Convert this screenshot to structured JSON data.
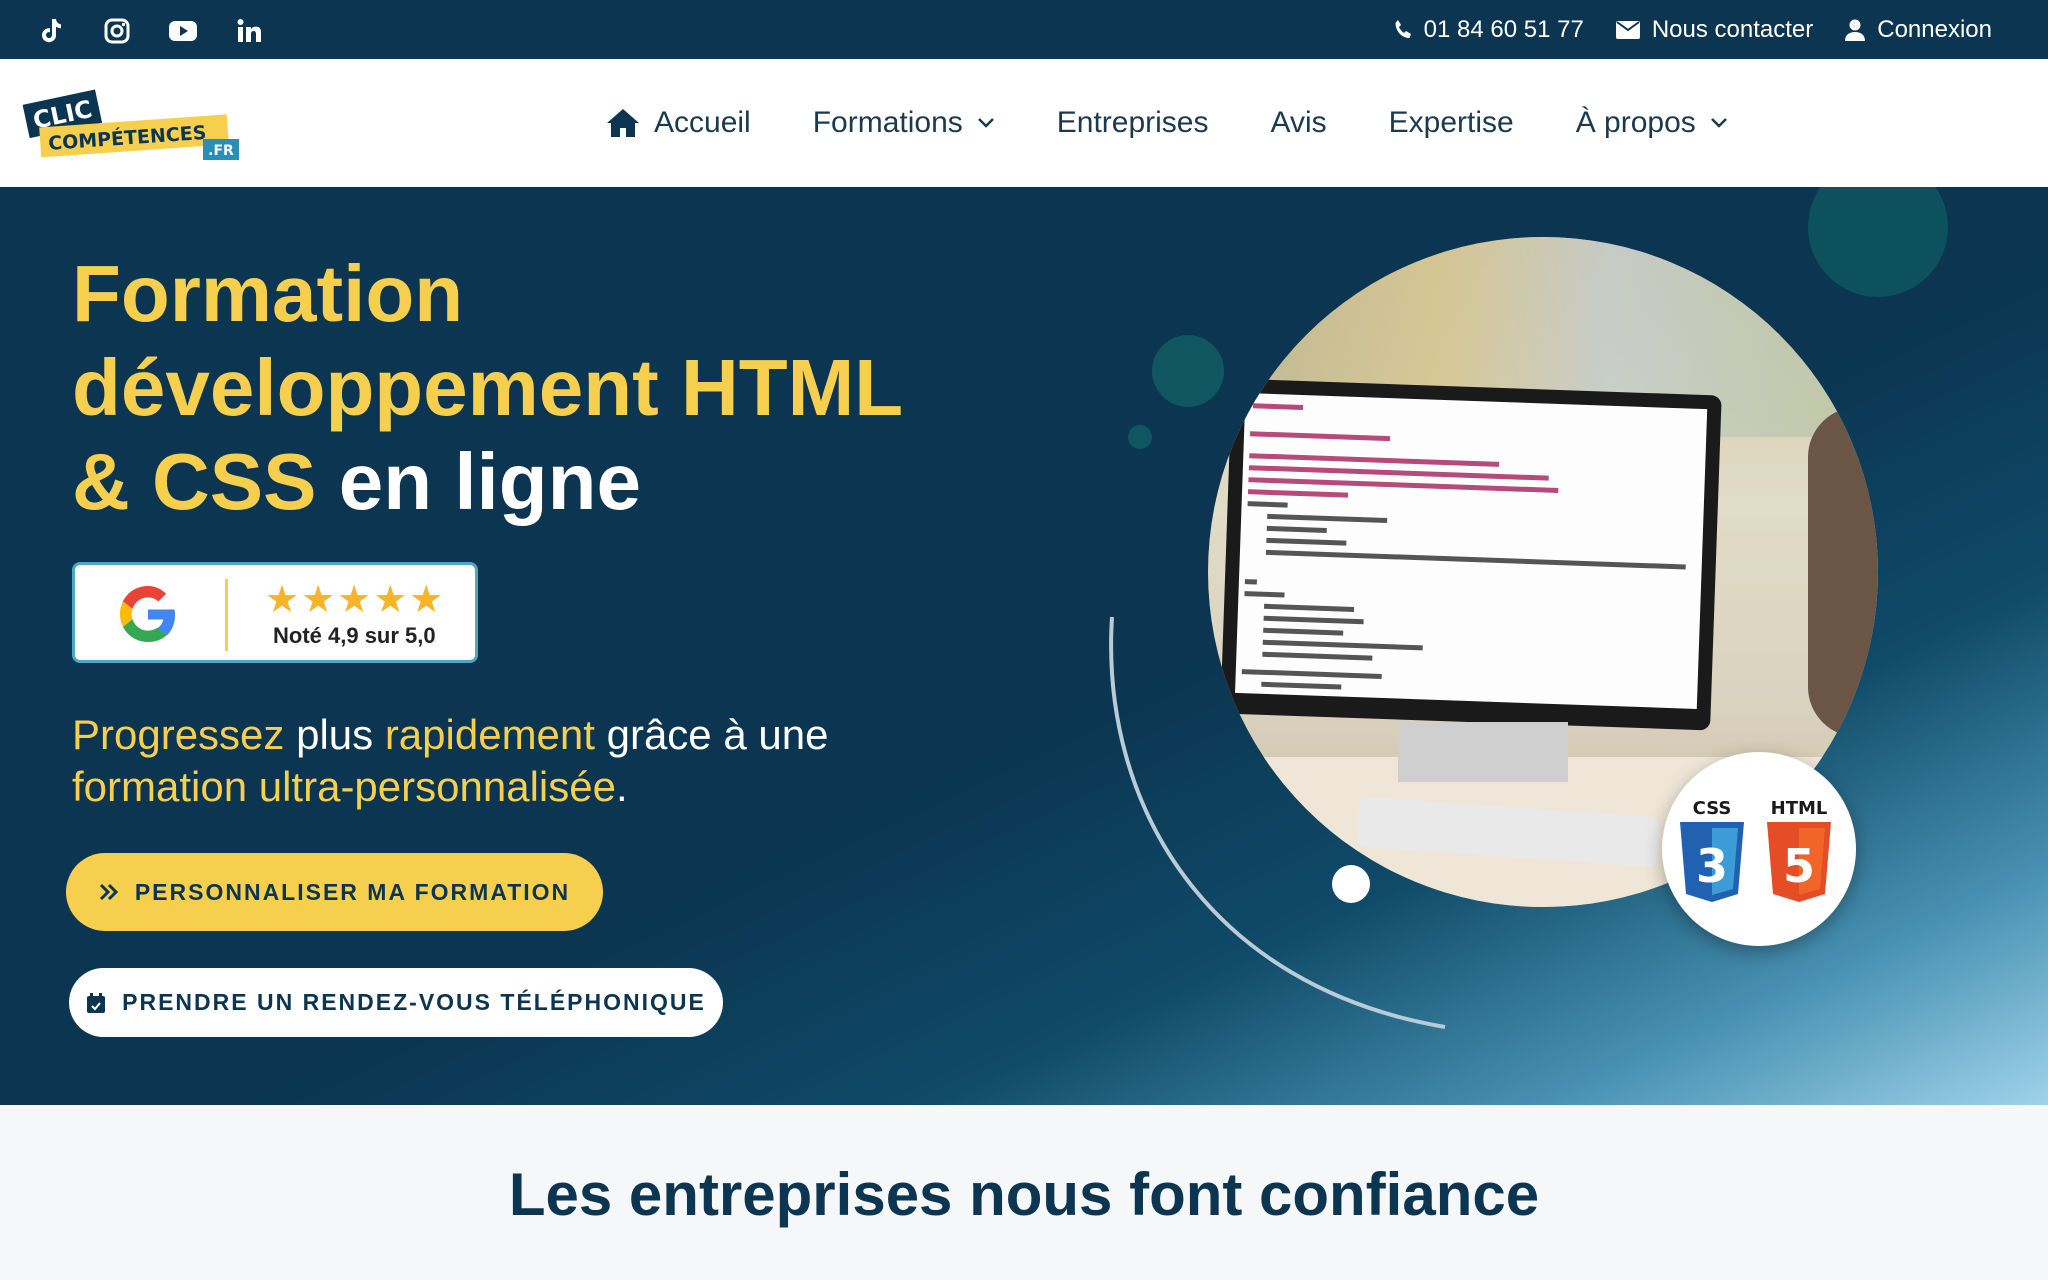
{
  "topbar": {
    "social": [
      {
        "icon": "tiktok-icon"
      },
      {
        "icon": "instagram-icon"
      },
      {
        "icon": "youtube-icon"
      },
      {
        "icon": "linkedin-icon"
      }
    ],
    "phone": "01 84 60 51 77",
    "contact_label": "Nous contacter",
    "login_label": "Connexion"
  },
  "brand": {
    "logo_line1": "CLIC",
    "logo_line2": "COMPÉTENCES",
    "logo_tld": ".FR"
  },
  "nav": {
    "items": [
      {
        "label": "Accueil",
        "icon": "home-icon"
      },
      {
        "label": "Formations",
        "dropdown": true
      },
      {
        "label": "Entreprises"
      },
      {
        "label": "Avis"
      },
      {
        "label": "Expertise"
      },
      {
        "label": "À propos",
        "dropdown": true
      }
    ]
  },
  "hero": {
    "title_yellow_1": "Formation développement HTML & CSS",
    "title_white": " en ligne",
    "rating": {
      "stars": 5,
      "text": "Noté 4,9 sur 5,0"
    },
    "tagline": {
      "p1": "Progressez",
      "p2": " plus ",
      "p3": "rapidement",
      "p4": " grâce à une ",
      "p5": "formation ultra-personnalisée",
      "p6": "."
    },
    "cta_primary": "PERSONNALISER MA FORMATION",
    "cta_secondary": "PRENDRE UN RENDEZ-VOUS TÉLÉPHONIQUE",
    "badge": {
      "css_label": "CSS",
      "html_label": "HTML",
      "css_digit": "3",
      "html_digit": "5"
    }
  },
  "trust": {
    "heading": "Les entreprises nous font confiance"
  },
  "colors": {
    "navy": "#0b3550",
    "yellow": "#f5cf4d",
    "teal": "#0f5660",
    "css_blue": "#2062af",
    "html_orange": "#e44d26"
  }
}
